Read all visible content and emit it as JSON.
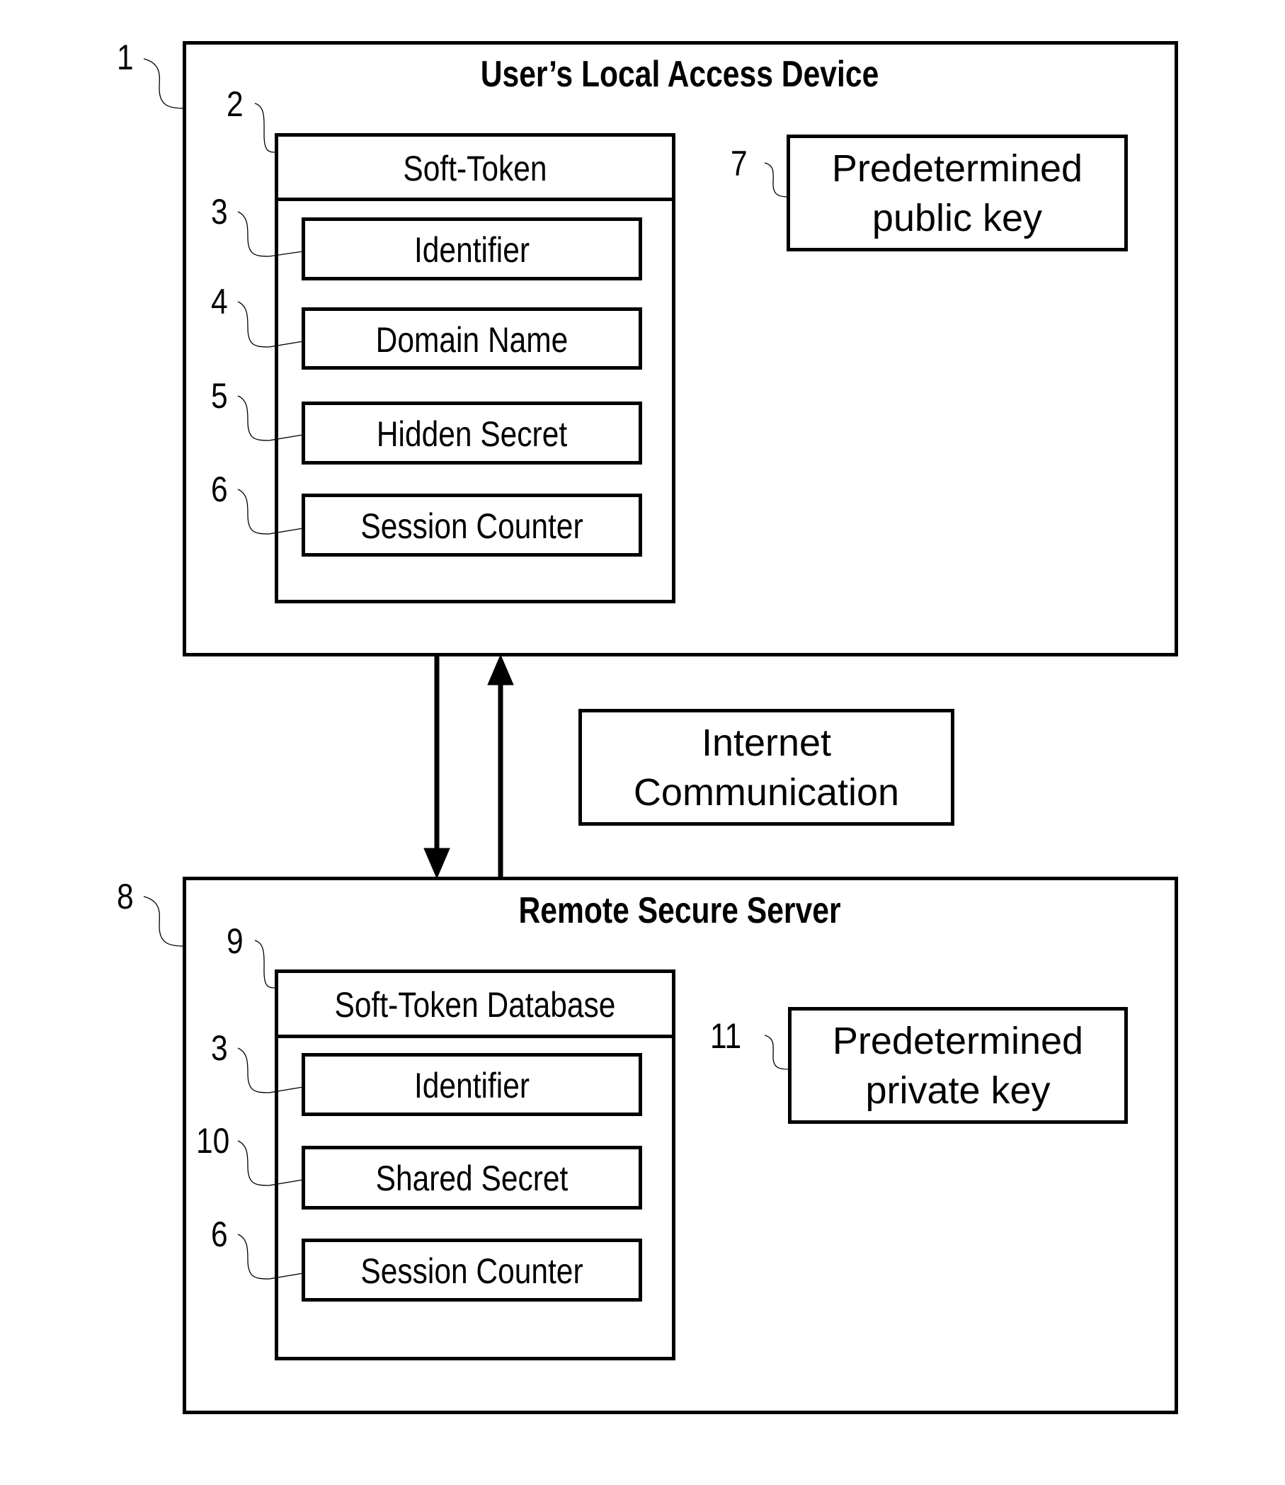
{
  "device": {
    "ref": "1",
    "title": "User’s Local Access Device",
    "soft_token": {
      "ref": "2",
      "header": "Soft-Token",
      "fields": [
        {
          "ref": "3",
          "label": "Identifier"
        },
        {
          "ref": "4",
          "label": "Domain Name"
        },
        {
          "ref": "5",
          "label": "Hidden Secret"
        },
        {
          "ref": "6",
          "label": "Session Counter"
        }
      ]
    },
    "key": {
      "ref": "7",
      "line1": "Predetermined",
      "line2": "public key"
    }
  },
  "link": {
    "line1": "Internet",
    "line2": "Communication"
  },
  "server": {
    "ref": "8",
    "title": "Remote Secure Server",
    "database": {
      "ref": "9",
      "header": "Soft-Token Database",
      "fields": [
        {
          "ref": "3",
          "label": "Identifier"
        },
        {
          "ref": "10",
          "label": "Shared Secret"
        },
        {
          "ref": "6",
          "label": "Session Counter"
        }
      ]
    },
    "key": {
      "ref": "11",
      "line1": "Predetermined",
      "line2": "private key"
    }
  }
}
